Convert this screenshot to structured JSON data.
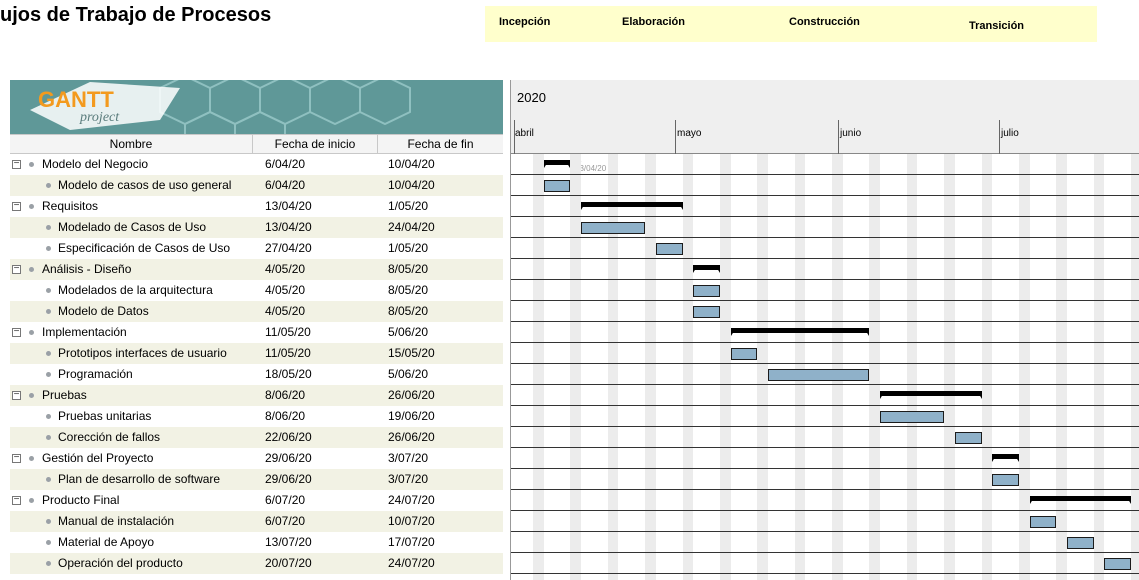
{
  "page_title": "ujos de Trabajo de Procesos",
  "phases": [
    "Incepción",
    "Elaboración",
    "Construcción",
    "Transición"
  ],
  "logo": {
    "brand": "GANTT",
    "sub": "project"
  },
  "columns": {
    "name": "Nombre",
    "start": "Fecha de inicio",
    "end": "Fecha de fin"
  },
  "year": "2020",
  "months": [
    "abril",
    "mayo",
    "junio",
    "julio"
  ],
  "today_marker": "13/04/20",
  "tasks": [
    {
      "name": "Modelo del Negocio",
      "start": "6/04/20",
      "end": "10/04/20",
      "group": true
    },
    {
      "name": "Modelo de casos de uso general",
      "start": "6/04/20",
      "end": "10/04/20",
      "group": false
    },
    {
      "name": "Requisitos",
      "start": "13/04/20",
      "end": "1/05/20",
      "group": true
    },
    {
      "name": "Modelado de Casos de Uso",
      "start": "13/04/20",
      "end": "24/04/20",
      "group": false
    },
    {
      "name": "Especificación de Casos de Uso",
      "start": "27/04/20",
      "end": "1/05/20",
      "group": false
    },
    {
      "name": "Análisis - Diseño",
      "start": "4/05/20",
      "end": "8/05/20",
      "group": true
    },
    {
      "name": "Modelados de la arquitectura",
      "start": "4/05/20",
      "end": "8/05/20",
      "group": false
    },
    {
      "name": "Modelo de Datos",
      "start": "4/05/20",
      "end": "8/05/20",
      "group": false
    },
    {
      "name": "Implementación",
      "start": "11/05/20",
      "end": "5/06/20",
      "group": true
    },
    {
      "name": "Prototipos interfaces de usuario",
      "start": "11/05/20",
      "end": "15/05/20",
      "group": false
    },
    {
      "name": "Programación",
      "start": "18/05/20",
      "end": "5/06/20",
      "group": false
    },
    {
      "name": "Pruebas",
      "start": "8/06/20",
      "end": "26/06/20",
      "group": true
    },
    {
      "name": "Pruebas unitarias",
      "start": "8/06/20",
      "end": "19/06/20",
      "group": false
    },
    {
      "name": "Corección de fallos",
      "start": "22/06/20",
      "end": "26/06/20",
      "group": false
    },
    {
      "name": "Gestión del Proyecto",
      "start": "29/06/20",
      "end": "3/07/20",
      "group": true
    },
    {
      "name": "Plan de desarrollo de software",
      "start": "29/06/20",
      "end": "3/07/20",
      "group": false
    },
    {
      "name": "Producto Final",
      "start": "6/07/20",
      "end": "24/07/20",
      "group": true
    },
    {
      "name": "Manual de instalación",
      "start": "6/07/20",
      "end": "10/07/20",
      "group": false
    },
    {
      "name": "Material de Apoyo",
      "start": "13/07/20",
      "end": "17/07/20",
      "group": false
    },
    {
      "name": "Operación del producto",
      "start": "20/07/20",
      "end": "24/07/20",
      "group": false
    }
  ]
}
